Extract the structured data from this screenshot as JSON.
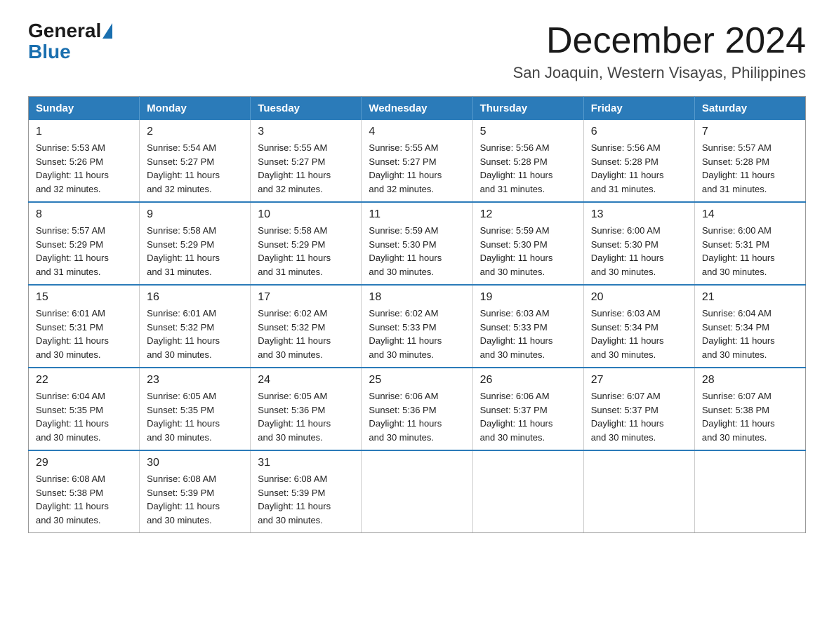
{
  "logo": {
    "general": "General",
    "blue": "Blue"
  },
  "header": {
    "month_title": "December 2024",
    "location": "San Joaquin, Western Visayas, Philippines"
  },
  "weekdays": [
    "Sunday",
    "Monday",
    "Tuesday",
    "Wednesday",
    "Thursday",
    "Friday",
    "Saturday"
  ],
  "weeks": [
    [
      {
        "day": "1",
        "info": "Sunrise: 5:53 AM\nSunset: 5:26 PM\nDaylight: 11 hours\nand 32 minutes."
      },
      {
        "day": "2",
        "info": "Sunrise: 5:54 AM\nSunset: 5:27 PM\nDaylight: 11 hours\nand 32 minutes."
      },
      {
        "day": "3",
        "info": "Sunrise: 5:55 AM\nSunset: 5:27 PM\nDaylight: 11 hours\nand 32 minutes."
      },
      {
        "day": "4",
        "info": "Sunrise: 5:55 AM\nSunset: 5:27 PM\nDaylight: 11 hours\nand 32 minutes."
      },
      {
        "day": "5",
        "info": "Sunrise: 5:56 AM\nSunset: 5:28 PM\nDaylight: 11 hours\nand 31 minutes."
      },
      {
        "day": "6",
        "info": "Sunrise: 5:56 AM\nSunset: 5:28 PM\nDaylight: 11 hours\nand 31 minutes."
      },
      {
        "day": "7",
        "info": "Sunrise: 5:57 AM\nSunset: 5:28 PM\nDaylight: 11 hours\nand 31 minutes."
      }
    ],
    [
      {
        "day": "8",
        "info": "Sunrise: 5:57 AM\nSunset: 5:29 PM\nDaylight: 11 hours\nand 31 minutes."
      },
      {
        "day": "9",
        "info": "Sunrise: 5:58 AM\nSunset: 5:29 PM\nDaylight: 11 hours\nand 31 minutes."
      },
      {
        "day": "10",
        "info": "Sunrise: 5:58 AM\nSunset: 5:29 PM\nDaylight: 11 hours\nand 31 minutes."
      },
      {
        "day": "11",
        "info": "Sunrise: 5:59 AM\nSunset: 5:30 PM\nDaylight: 11 hours\nand 30 minutes."
      },
      {
        "day": "12",
        "info": "Sunrise: 5:59 AM\nSunset: 5:30 PM\nDaylight: 11 hours\nand 30 minutes."
      },
      {
        "day": "13",
        "info": "Sunrise: 6:00 AM\nSunset: 5:30 PM\nDaylight: 11 hours\nand 30 minutes."
      },
      {
        "day": "14",
        "info": "Sunrise: 6:00 AM\nSunset: 5:31 PM\nDaylight: 11 hours\nand 30 minutes."
      }
    ],
    [
      {
        "day": "15",
        "info": "Sunrise: 6:01 AM\nSunset: 5:31 PM\nDaylight: 11 hours\nand 30 minutes."
      },
      {
        "day": "16",
        "info": "Sunrise: 6:01 AM\nSunset: 5:32 PM\nDaylight: 11 hours\nand 30 minutes."
      },
      {
        "day": "17",
        "info": "Sunrise: 6:02 AM\nSunset: 5:32 PM\nDaylight: 11 hours\nand 30 minutes."
      },
      {
        "day": "18",
        "info": "Sunrise: 6:02 AM\nSunset: 5:33 PM\nDaylight: 11 hours\nand 30 minutes."
      },
      {
        "day": "19",
        "info": "Sunrise: 6:03 AM\nSunset: 5:33 PM\nDaylight: 11 hours\nand 30 minutes."
      },
      {
        "day": "20",
        "info": "Sunrise: 6:03 AM\nSunset: 5:34 PM\nDaylight: 11 hours\nand 30 minutes."
      },
      {
        "day": "21",
        "info": "Sunrise: 6:04 AM\nSunset: 5:34 PM\nDaylight: 11 hours\nand 30 minutes."
      }
    ],
    [
      {
        "day": "22",
        "info": "Sunrise: 6:04 AM\nSunset: 5:35 PM\nDaylight: 11 hours\nand 30 minutes."
      },
      {
        "day": "23",
        "info": "Sunrise: 6:05 AM\nSunset: 5:35 PM\nDaylight: 11 hours\nand 30 minutes."
      },
      {
        "day": "24",
        "info": "Sunrise: 6:05 AM\nSunset: 5:36 PM\nDaylight: 11 hours\nand 30 minutes."
      },
      {
        "day": "25",
        "info": "Sunrise: 6:06 AM\nSunset: 5:36 PM\nDaylight: 11 hours\nand 30 minutes."
      },
      {
        "day": "26",
        "info": "Sunrise: 6:06 AM\nSunset: 5:37 PM\nDaylight: 11 hours\nand 30 minutes."
      },
      {
        "day": "27",
        "info": "Sunrise: 6:07 AM\nSunset: 5:37 PM\nDaylight: 11 hours\nand 30 minutes."
      },
      {
        "day": "28",
        "info": "Sunrise: 6:07 AM\nSunset: 5:38 PM\nDaylight: 11 hours\nand 30 minutes."
      }
    ],
    [
      {
        "day": "29",
        "info": "Sunrise: 6:08 AM\nSunset: 5:38 PM\nDaylight: 11 hours\nand 30 minutes."
      },
      {
        "day": "30",
        "info": "Sunrise: 6:08 AM\nSunset: 5:39 PM\nDaylight: 11 hours\nand 30 minutes."
      },
      {
        "day": "31",
        "info": "Sunrise: 6:08 AM\nSunset: 5:39 PM\nDaylight: 11 hours\nand 30 minutes."
      },
      {
        "day": "",
        "info": ""
      },
      {
        "day": "",
        "info": ""
      },
      {
        "day": "",
        "info": ""
      },
      {
        "day": "",
        "info": ""
      }
    ]
  ]
}
